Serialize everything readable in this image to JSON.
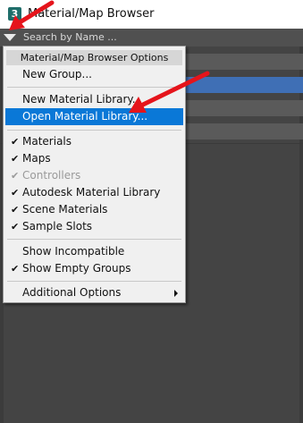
{
  "window": {
    "icon_text": "3",
    "title": "Material/Map Browser"
  },
  "search": {
    "placeholder": "Search by Name ..."
  },
  "menu": {
    "header": "Material/Map Browser Options",
    "new_group": "New Group...",
    "new_material_library": "New Material Library...",
    "open_material_library": "Open Material Library...",
    "materials": "Materials",
    "maps": "Maps",
    "controllers": "Controllers",
    "autodesk_material_library": "Autodesk Material Library",
    "scene_materials": "Scene Materials",
    "sample_slots": "Sample Slots",
    "show_incompatible": "Show Incompatible",
    "show_empty_groups": "Show Empty Groups",
    "additional_options": "Additional Options",
    "check_mark": "✔"
  },
  "colors": {
    "highlight": "#0a78d7",
    "annotation_arrow": "#e5141b",
    "app_icon": "#1f6e6a"
  }
}
